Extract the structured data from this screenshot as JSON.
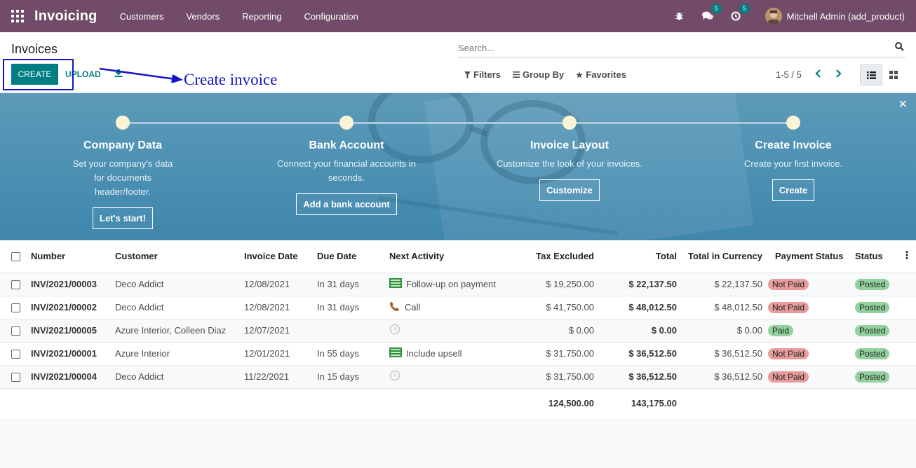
{
  "navbar": {
    "app_name": "Invoicing",
    "menu": [
      "Customers",
      "Vendors",
      "Reporting",
      "Configuration"
    ],
    "messages_count": "5",
    "activities_count": "5",
    "user_name": "Mitchell Admin (add_product)"
  },
  "control": {
    "title": "Invoices",
    "search_placeholder": "Search...",
    "create_label": "CREATE",
    "upload_label": "UPLOAD",
    "filters_label": "Filters",
    "groupby_label": "Group By",
    "favorites_label": "Favorites",
    "pager": "1-5 / 5",
    "annotation": "Create invoice"
  },
  "banner": {
    "steps": [
      {
        "title": "Company Data",
        "desc": "Set your company's data for documents header/footer.",
        "button": "Let's start!"
      },
      {
        "title": "Bank Account",
        "desc": "Connect your financial accounts in seconds.",
        "button": "Add a bank account"
      },
      {
        "title": "Invoice Layout",
        "desc": "Customize the look of your invoices.",
        "button": "Customize"
      },
      {
        "title": "Create Invoice",
        "desc": "Create your first invoice.",
        "button": "Create"
      }
    ]
  },
  "table": {
    "columns": [
      "Number",
      "Customer",
      "Invoice Date",
      "Due Date",
      "Next Activity",
      "Tax Excluded",
      "Total",
      "Total in Currency",
      "Payment Status",
      "Status"
    ],
    "rows": [
      {
        "number": "INV/2021/00003",
        "customer": "Deco Addict",
        "invoice_date": "12/08/2021",
        "due_date": "In 31 days",
        "activity": "Follow-up on payment",
        "activity_icon": "task-icon",
        "tax_excl": "$ 19,250.00",
        "total": "$ 22,137.50",
        "total_currency": "$ 22,137.50",
        "payment_status": "Not Paid",
        "status": "Posted"
      },
      {
        "number": "INV/2021/00002",
        "customer": "Deco Addict",
        "invoice_date": "12/08/2021",
        "due_date": "In 31 days",
        "activity": "Call",
        "activity_icon": "phone-icon",
        "tax_excl": "$ 41,750.00",
        "total": "$ 48,012.50",
        "total_currency": "$ 48,012.50",
        "payment_status": "Not Paid",
        "status": "Posted"
      },
      {
        "number": "INV/2021/00005",
        "customer": "Azure Interior, Colleen Diaz",
        "invoice_date": "12/07/2021",
        "due_date": "",
        "activity": "",
        "activity_icon": "clock-icon",
        "tax_excl": "$ 0.00",
        "total": "$ 0.00",
        "total_currency": "$ 0.00",
        "payment_status": "Paid",
        "status": "Posted"
      },
      {
        "number": "INV/2021/00001",
        "customer": "Azure Interior",
        "invoice_date": "12/01/2021",
        "due_date": "In 55 days",
        "activity": "Include upsell",
        "activity_icon": "task-icon",
        "tax_excl": "$ 31,750.00",
        "total": "$ 36,512.50",
        "total_currency": "$ 36,512.50",
        "payment_status": "Not Paid",
        "status": "Posted"
      },
      {
        "number": "INV/2021/00004",
        "customer": "Deco Addict",
        "invoice_date": "11/22/2021",
        "due_date": "In 15 days",
        "activity": "",
        "activity_icon": "clock-icon",
        "tax_excl": "$ 31,750.00",
        "total": "$ 36,512.50",
        "total_currency": "$ 36,512.50",
        "payment_status": "Not Paid",
        "status": "Posted"
      }
    ],
    "footer": {
      "tax_excl_sum": "124,500.00",
      "total_sum": "143,175.00"
    }
  },
  "colors": {
    "navbar": "#714b67",
    "primary": "#017e84",
    "annotation": "#1414c8"
  }
}
